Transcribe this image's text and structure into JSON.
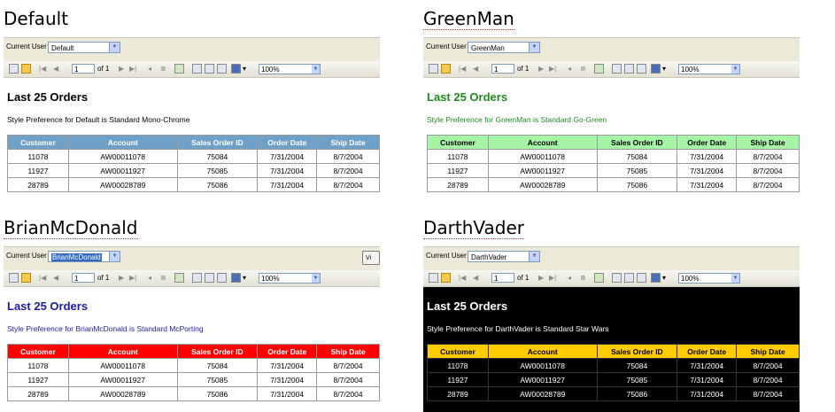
{
  "toolbar": {
    "page_current": "1",
    "page_of": "of 1",
    "zoom": "100%",
    "nav_icons": [
      "first-page-icon",
      "previous-page-icon",
      "next-page-icon",
      "last-page-icon",
      "back-icon",
      "stop-icon",
      "refresh-icon",
      "print-icon",
      "print-layout-icon",
      "page-setup-icon",
      "export-icon"
    ]
  },
  "labels": {
    "current_user": "Current User",
    "view_button_partial": "Vi"
  },
  "report": {
    "title": "Last 25 Orders",
    "columns": [
      "Customer",
      "Account",
      "Sales Order ID",
      "Order Date",
      "Ship Date"
    ],
    "rows": [
      [
        "11078",
        "AW00011078",
        "75084",
        "7/31/2004",
        "8/7/2004"
      ],
      [
        "11927",
        "AW00011927",
        "75085",
        "7/31/2004",
        "8/7/2004"
      ],
      [
        "28789",
        "AW00028789",
        "75086",
        "7/31/2004",
        "8/7/2004"
      ]
    ]
  },
  "panels": [
    {
      "heading": "Default",
      "user_value": "Default",
      "subtitle": "Style Preference for Default is Standard Mono-Chrome",
      "colors": {
        "content_bg": "#ffffff",
        "title": "#000000",
        "subtitle": "#000000",
        "header_bg": "#6fa0c8",
        "header_text": "#ffffff",
        "cell_text": "#000000",
        "border": "#9a9a9a"
      }
    },
    {
      "heading": "GreenMan",
      "user_value": "GreenMan",
      "subtitle": "Style Preference for GreenMan is Standard Go-Green",
      "colors": {
        "content_bg": "#ffffff",
        "title": "#1f8a1f",
        "subtitle": "#1f8a1f",
        "header_bg": "#a6f5a6",
        "header_text": "#000000",
        "cell_text": "#000000",
        "border": "#9a9a9a"
      }
    },
    {
      "heading": "BrianMcDonald",
      "user_value": "BrianMcDonald",
      "subtitle": "Style Preference for BrianMcDonald is Standard McPorting",
      "colors": {
        "content_bg": "#ffffff",
        "title": "#1c1ca8",
        "subtitle": "#1c1ca8",
        "header_bg": "#ff0000",
        "header_text": "#ffffff",
        "cell_text": "#000000",
        "border": "#9a9a9a"
      }
    },
    {
      "heading": "DarthVader",
      "user_value": "DarthVader",
      "subtitle": "Style Preference for DarthVader is Standard Star Wars",
      "colors": {
        "content_bg": "#000000",
        "title": "#ffffff",
        "subtitle": "#ffffff",
        "header_bg": "#ffcc00",
        "header_text": "#000000",
        "cell_text": "#ffffff",
        "border": "#333333"
      }
    }
  ]
}
